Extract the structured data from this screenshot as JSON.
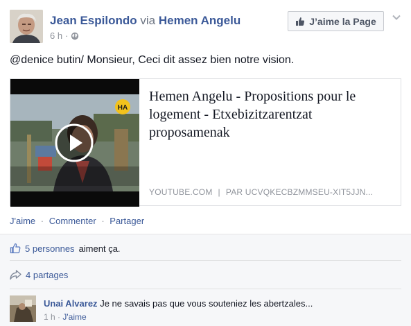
{
  "post": {
    "author": "Jean Espilondo",
    "via": "via",
    "page": "Hemen Angelu",
    "time": "6 h",
    "meta_dot": "·",
    "like_page_button": "J’aime la Page",
    "message": "@denice butin/ Monsieur, Ceci dit assez bien notre vision."
  },
  "link_card": {
    "title": "Hemen Angelu - Propositions pour le logement - Etxebizitzarentzat proposamenak",
    "source": "YOUTUBE.COM",
    "separator": "|",
    "byline": "PAR UCVQKECBZMMSEU-XIT5JJN..."
  },
  "actions": {
    "like": "J'aime",
    "comment": "Commenter",
    "share": "Partager",
    "separator": "·"
  },
  "ufi": {
    "likes_link": "5 personnes",
    "likes_text": "aiment ça.",
    "shares": "4 partages"
  },
  "comment": {
    "author": "Unai Alvarez",
    "text": "Je ne savais pas que vous souteniez les abertzales...",
    "time": "1 h",
    "dot": "·",
    "like": "J'aime"
  },
  "colors": {
    "link_blue": "#3b5998",
    "text": "#141823",
    "muted": "#90949c",
    "ufi_bg": "#f6f7f9"
  },
  "icons": [
    "globe-icon",
    "thumbs-up-icon",
    "chevron-down-icon",
    "play-icon",
    "share-arrow-icon"
  ]
}
